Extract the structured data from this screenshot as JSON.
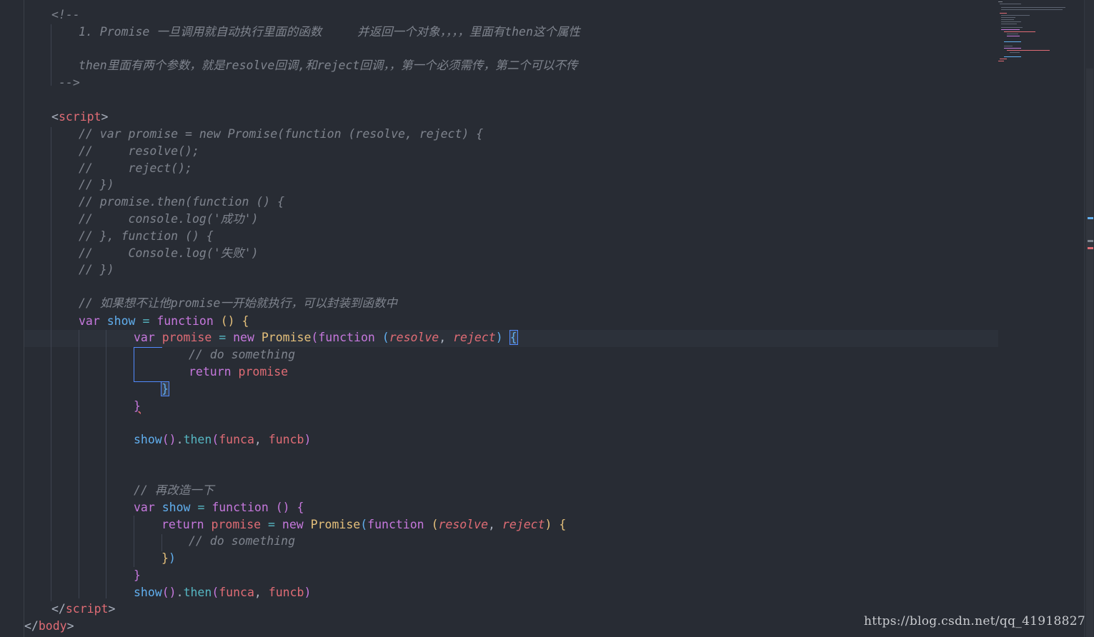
{
  "code": {
    "comment_open": "<!--",
    "note1": "1. Promise 一旦调用就自动执行里面的函数     并返回一个对象，，，，里面有then这个属性",
    "note2": "then里面有两个参数，就是resolve回调,和reject回调，，第一个必须需传，第二个可以不传",
    "comment_close": "-->",
    "script_tag": "script",
    "body_tag": "body",
    "c_line1": "// var promise = new Promise(function (resolve, reject) {",
    "c_line2": "//     resolve();",
    "c_line3": "//     reject();",
    "c_line4": "// })",
    "c_line5": "// promise.then(function () {",
    "c_line6": "//     console.log('成功')",
    "c_line7": "// }, function () {",
    "c_line8": "//     Console.log('失败')",
    "c_line9": "// })",
    "c_wrap": "// 如果想不让他promise一开始就执行，可以封装到函数中",
    "c_do": "// do something",
    "c_refactor": "// 再改造一下",
    "kw_var": "var",
    "kw_function": "function",
    "kw_new": "new",
    "kw_return": "return",
    "id_show": "show",
    "id_promise": "promise",
    "id_Promise": "Promise",
    "id_then": "then",
    "id_funca": "funca",
    "id_funcb": "funcb",
    "param_resolve": "resolve",
    "param_reject": "reject"
  },
  "watermark": "https://blog.csdn.net/qq_41918827",
  "theme": {
    "background": "#282c34",
    "comment": "#7f848e",
    "keyword": "#c678dd",
    "variable": "#e06c75",
    "function": "#61afef",
    "class": "#e5c07b",
    "operator": "#56b6c2"
  }
}
